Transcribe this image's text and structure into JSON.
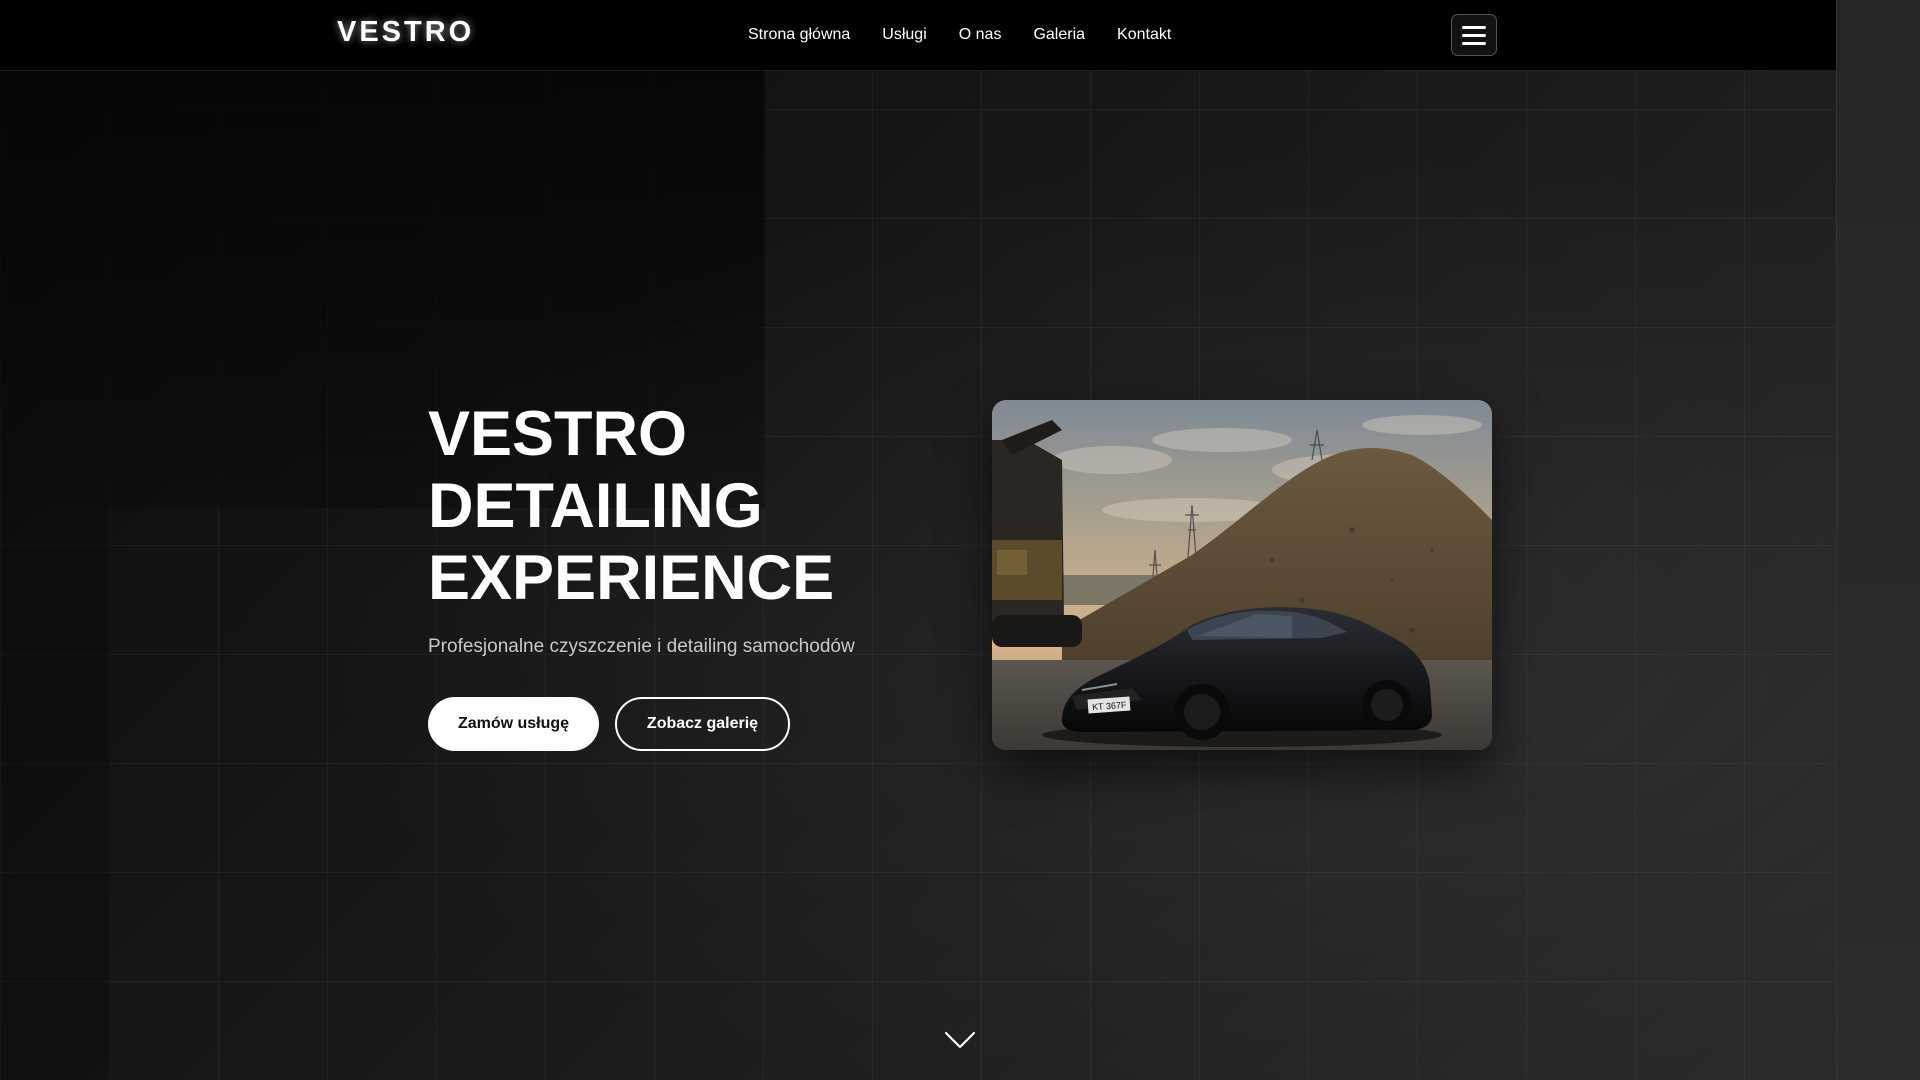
{
  "brand": {
    "logo": "VESTRO"
  },
  "nav": {
    "items": [
      {
        "label": "Strona główna"
      },
      {
        "label": "Usługi"
      },
      {
        "label": "O nas"
      },
      {
        "label": "Galeria"
      },
      {
        "label": "Kontakt"
      }
    ],
    "menu_icon": "hamburger-menu-icon"
  },
  "hero": {
    "title_lines": [
      "VESTRO",
      "DETAILING",
      "EXPERIENCE"
    ],
    "subtitle": "Profesjonalne czyszczenie i detailing samochodów",
    "primary_button": "Zamów usługę",
    "secondary_button": "Zobacz galerię",
    "scroll_icon": "chevron-down-icon"
  },
  "photo": {
    "plate": "KT 367F"
  },
  "colors": {
    "navbar": "#000000",
    "background": "#141414",
    "text": "#ffffff",
    "subtitle": "#c9c9c9",
    "accent": "#ffffff"
  }
}
